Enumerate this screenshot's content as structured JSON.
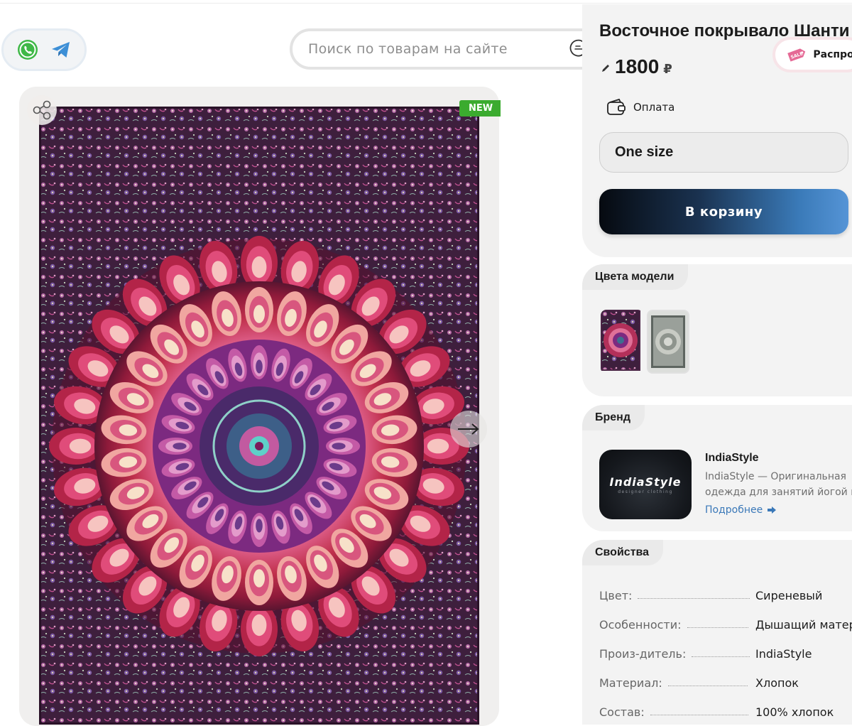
{
  "search": {
    "placeholder": "Поиск по товарам на сайте"
  },
  "messengers": [
    {
      "icon": "whatsapp-icon"
    },
    {
      "icon": "telegram-icon"
    }
  ],
  "gallery": {
    "badge": "NEW"
  },
  "product": {
    "title": "Восточное покрывало Шанти",
    "sale_label": "Распрод",
    "price": "1800",
    "currency": "₽",
    "payment_label": "Оплата",
    "size": "One size",
    "cart_button": "В корзину"
  },
  "colors": {
    "heading": "Цвета модели"
  },
  "brand": {
    "heading": "Бренд",
    "logo_text": "IndiaStyle",
    "logo_sub": "designer clothing",
    "name": "IndiaStyle",
    "desc_line1": "IndiaStyle — Оригинальная",
    "desc_line2": "одежда для занятий йогой и",
    "more": "Подробнее"
  },
  "properties": {
    "heading": "Свойства",
    "rows": [
      {
        "key": "Цвет:",
        "value": "Сиреневый"
      },
      {
        "key": "Особенности:",
        "value": "Дышащий материал"
      },
      {
        "key": "Произ-дитель:",
        "value": "IndiaStyle"
      },
      {
        "key": "Материал:",
        "value": "Хлопок"
      },
      {
        "key": "Состав:",
        "value": "100% хлопок"
      }
    ]
  },
  "colors_palette": {
    "brand_green": "#3bab2f",
    "link": "#3a78b8",
    "accent_pink": "#e2467a"
  }
}
